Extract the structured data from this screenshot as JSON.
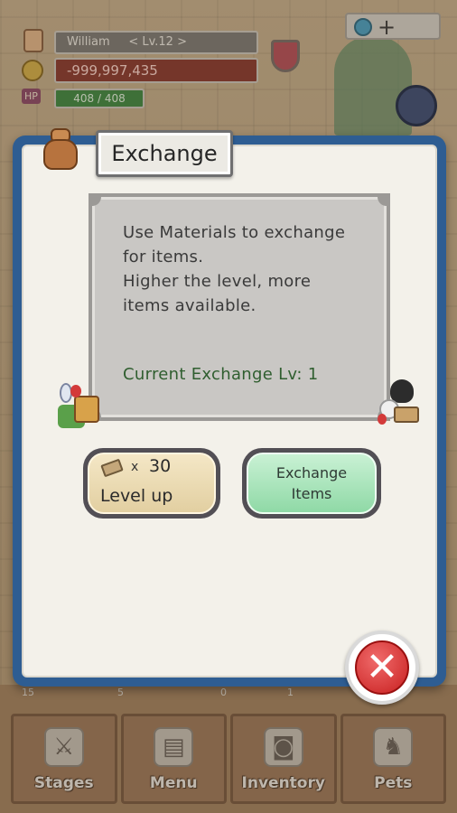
{
  "hud": {
    "player_name": "William",
    "player_level": "< Lv.12 >",
    "gold": "-999,997,435",
    "hp_label": "HP",
    "hp": "408 / 408"
  },
  "dialog": {
    "title": "Exchange",
    "info_lines": [
      "Use Materials to exchange",
      "for items.",
      "Higher the level, more",
      "items available."
    ],
    "current_level_text": "Current Exchange Lv: 1",
    "level_up": {
      "cost_prefix": "x",
      "cost_value": "30",
      "label": "Level up"
    },
    "exchange_button": {
      "line1": "Exchange",
      "line2": "Items"
    }
  },
  "counters": [
    "15",
    "5",
    "0",
    "1"
  ],
  "nav": {
    "items": [
      {
        "label": "Stages",
        "icon": "crossed-swords-icon"
      },
      {
        "label": "Menu",
        "icon": "book-icon"
      },
      {
        "label": "Inventory",
        "icon": "backpack-icon"
      },
      {
        "label": "Pets",
        "icon": "dragon-icon"
      }
    ]
  },
  "colors": {
    "dialog_frame": "#2e5d92",
    "level_up_button": "#f4e7c6",
    "exchange_button": "#8fd9a6",
    "close_button": "#c81f1f",
    "current_level_text": "#2f5e2f"
  }
}
